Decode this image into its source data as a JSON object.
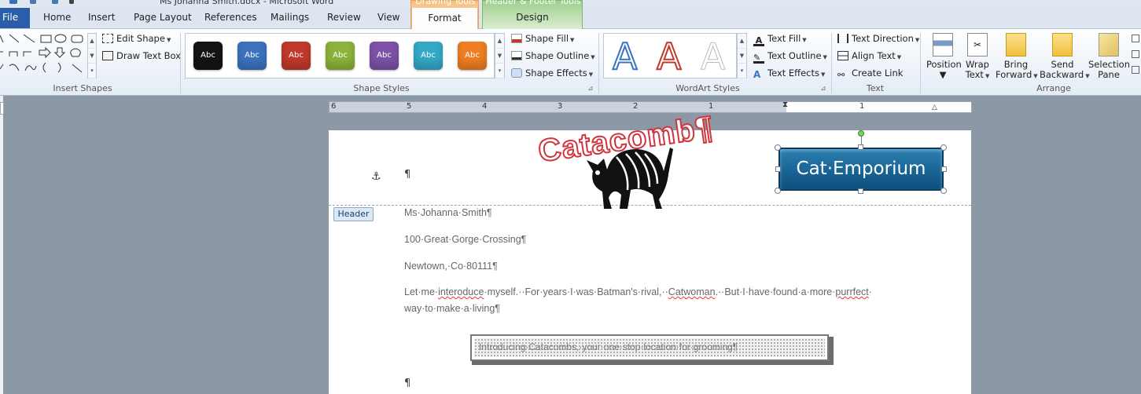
{
  "window": {
    "title": "Ms Johanna Smith.docx - Microsoft Word"
  },
  "tabs": {
    "file": "File",
    "home": "Home",
    "insert": "Insert",
    "page_layout": "Page Layout",
    "references": "References",
    "mailings": "Mailings",
    "review": "Review",
    "view": "View",
    "drawing_tools": "Drawing Tools",
    "format": "Format",
    "header_footer_tools": "Header & Footer Tools",
    "design": "Design"
  },
  "insert_shapes": {
    "label": "Insert Shapes",
    "edit_shape": "Edit Shape",
    "draw_text_box": "Draw Text Box"
  },
  "shape_styles": {
    "label": "Shape Styles",
    "swatch_text": "Abc",
    "swatches": [
      "#141414",
      "#3b73bf",
      "#c0392b",
      "#8db33a",
      "#7d52a8",
      "#34a9c7",
      "#ef7f22"
    ],
    "shape_fill": "Shape Fill",
    "shape_outline": "Shape Outline",
    "shape_effects": "Shape Effects"
  },
  "wordart_styles": {
    "label": "WordArt Styles",
    "letter": "A",
    "text_fill": "Text Fill",
    "text_outline": "Text Outline",
    "text_effects": "Text Effects"
  },
  "text_group": {
    "label": "Text",
    "text_direction": "Text Direction",
    "align_text": "Align Text",
    "create_link": "Create Link"
  },
  "arrange": {
    "label": "Arrange",
    "position": "Position",
    "wrap_text_1": "Wrap",
    "wrap_text_2": "Text",
    "bring_forward_1": "Bring",
    "bring_forward_2": "Forward",
    "send_backward_1": "Send",
    "send_backward_2": "Backward",
    "selection_pane_1": "Selection",
    "selection_pane_2": "Pane"
  },
  "ruler": {
    "numbers": [
      "6",
      "5",
      "4",
      "3",
      "2",
      "1",
      "1"
    ]
  },
  "document": {
    "header_tag": "Header",
    "pilcrow": "¶",
    "wordart_catacombs": "Catacomb¶",
    "wordart_emporium": "Cat·Emporium",
    "line_name": "Ms·Johanna·Smith¶",
    "line_street": "100·Great·Gorge·Crossing¶",
    "line_city": "Newtown,·Co·80111¶",
    "para1_a": "Let·me·",
    "para1_interoduce": "interoduce",
    "para1_b": "·myself.··For·years·I·was·Batman's·rival,··",
    "para1_catwoman": "Catwoman",
    "para1_c": ".··But·I·have·found·a·more·",
    "para1_purrfect": "purrfect",
    "para1_d": "·",
    "para1_line2": "way·to·make·a·living¶",
    "textbox_text": "Introducing·Catacombs,·your·one·stop·location·for·grooming¶"
  },
  "colors": {
    "file_tab": "#2a5ea8",
    "drawing_tools": "#f5c07d",
    "header_footer_tools": "#9fd08e",
    "emporium_fill": "#1c6a9a",
    "catacomb_outline": "#d0343f"
  }
}
